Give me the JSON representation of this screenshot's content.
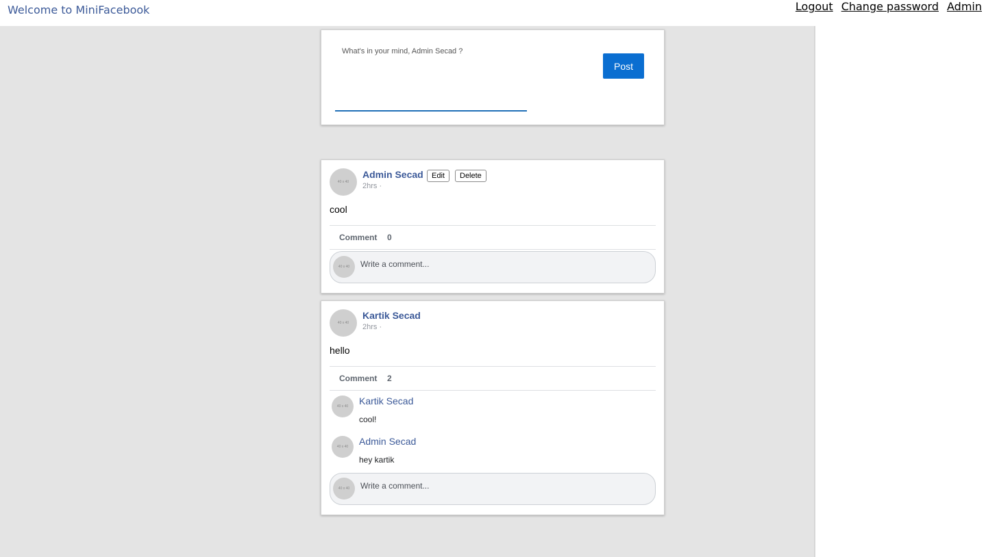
{
  "header": {
    "brand": "Welcome to MiniFacebook",
    "nav": {
      "logout": "Logout",
      "change_password": "Change password",
      "admin": "Admin"
    }
  },
  "composer": {
    "prompt": "What's in your mind, Admin Secad ?",
    "post_label": "Post"
  },
  "avatar_placeholder": "40 x 40",
  "posts": [
    {
      "author": "Admin Secad",
      "time": "2hrs ·",
      "edit_label": "Edit",
      "delete_label": "Delete",
      "content": "cool",
      "comment_label": "Comment",
      "comment_count": "0",
      "comment_placeholder": "Write a comment..."
    },
    {
      "author": "Kartik Secad",
      "time": "2hrs ·",
      "content": "hello",
      "comment_label": "Comment",
      "comment_count": "2",
      "comments": [
        {
          "author": "Kartik Secad",
          "text": "cool!"
        },
        {
          "author": "Admin Secad",
          "text": "hey kartik"
        }
      ],
      "comment_placeholder": "Write a comment..."
    }
  ],
  "colors": {
    "link_blue": "#3b5998",
    "button_blue": "#0a6ed1",
    "page_gray": "#e4e4e4"
  }
}
